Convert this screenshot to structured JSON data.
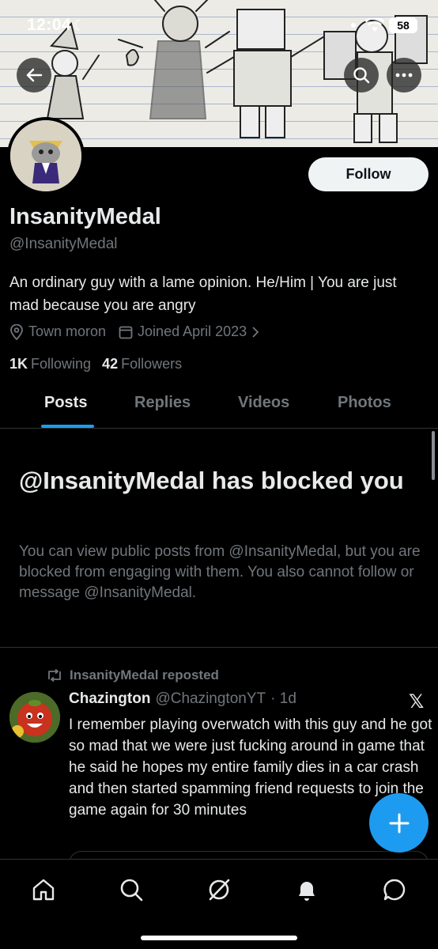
{
  "status_bar": {
    "time": "12:04",
    "battery": "58"
  },
  "profile": {
    "display_name": "InsanityMedal",
    "handle": "@InsanityMedal",
    "bio": "An ordinary guy with a lame opinion. He/Him | You are just mad because you are angry",
    "location": "Town moron",
    "joined": "Joined April 2023",
    "following_count": "1K",
    "following_label": "Following",
    "followers_count": "42",
    "followers_label": "Followers",
    "follow_button": "Follow"
  },
  "tabs": [
    {
      "label": "Posts",
      "active": true
    },
    {
      "label": "Replies",
      "active": false
    },
    {
      "label": "Videos",
      "active": false
    },
    {
      "label": "Photos",
      "active": false
    }
  ],
  "blocked": {
    "title": "@InsanityMedal has blocked you",
    "text": "You can view public posts from @InsanityMedal, but you are blocked from engaging with them. You also cannot follow or message @InsanityMedal."
  },
  "post": {
    "repost_label": "InsanityMedal reposted",
    "author": "Chazington",
    "author_handle": "@ChazingtonYT",
    "time": "· 1d",
    "text": "I remember playing overwatch with this guy and he got so mad that we were just fucking around in game that he said he hopes my entire family dies in a car crash and then started spamming friend requests to join the game again for 30 minutes",
    "source_logo": "𝕏"
  },
  "icons": {
    "back": "back-arrow-icon",
    "search": "search-icon",
    "more": "more-icon",
    "compose": "plus-icon",
    "nav": [
      "home-icon",
      "search-icon",
      "grok-icon",
      "bell-icon",
      "messages-icon"
    ]
  },
  "colors": {
    "accent": "#1d9bf0",
    "background": "#000000",
    "muted": "#71767b"
  }
}
